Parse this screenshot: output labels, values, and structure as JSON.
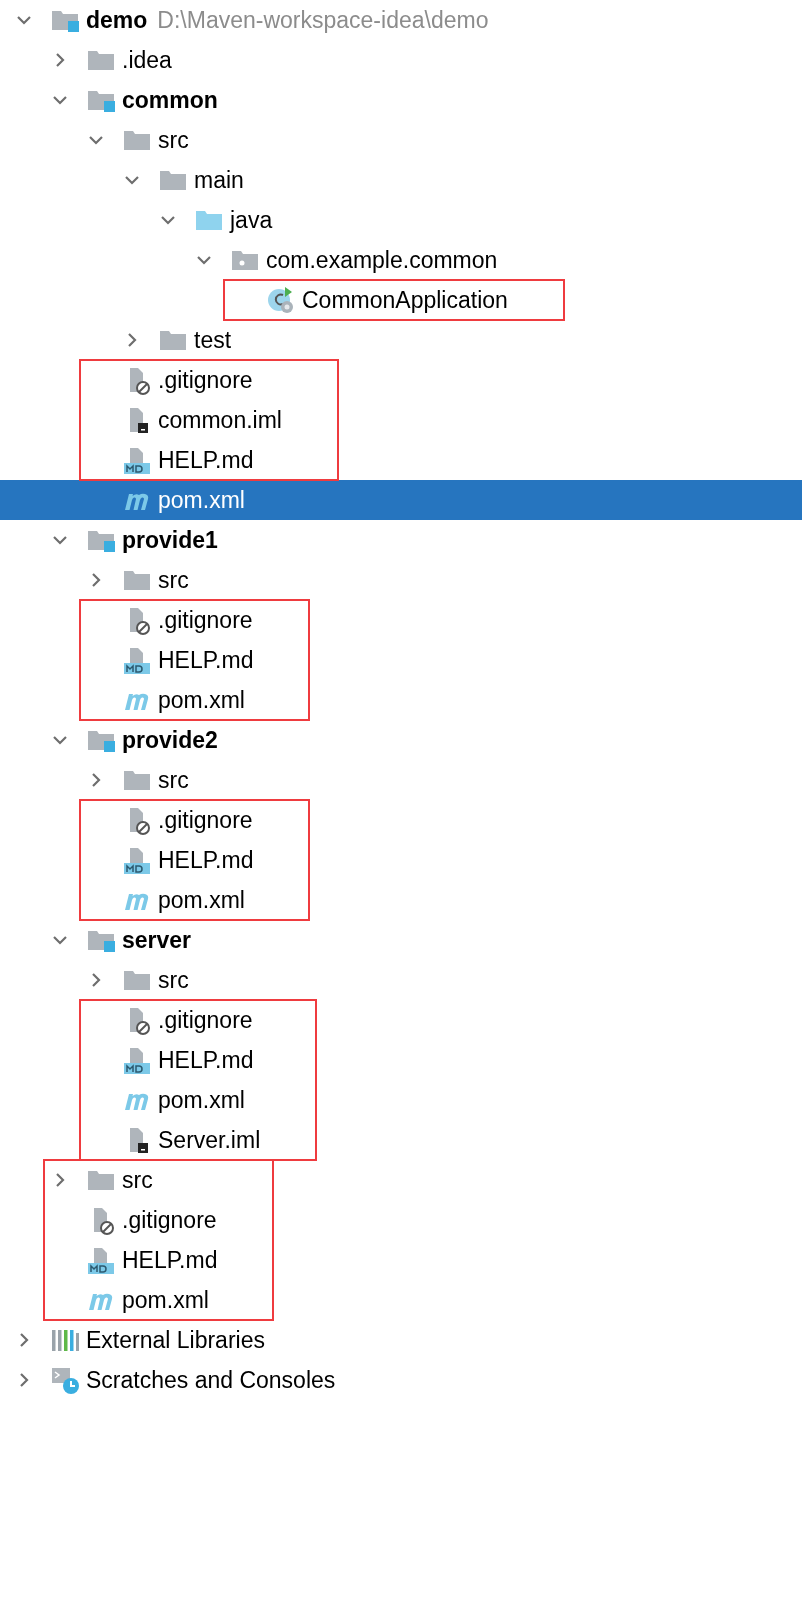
{
  "project_tree": [
    {
      "name": "demo",
      "kind": "module",
      "hint": "D:\\Maven-workspace-idea\\demo",
      "expanded": true,
      "selected": false,
      "highlighted": false,
      "children": [
        {
          "name": ".idea",
          "kind": "folder",
          "expanded": false,
          "selected": false,
          "highlighted": false
        },
        {
          "name": "common",
          "kind": "module",
          "expanded": true,
          "selected": false,
          "highlighted": false,
          "children": [
            {
              "name": "src",
              "kind": "folder",
              "expanded": true,
              "selected": false,
              "highlighted": false,
              "children": [
                {
                  "name": "main",
                  "kind": "folder",
                  "expanded": true,
                  "selected": false,
                  "highlighted": false,
                  "children": [
                    {
                      "name": "java",
                      "kind": "source_folder",
                      "expanded": true,
                      "selected": false,
                      "highlighted": false,
                      "children": [
                        {
                          "name": "com.example.common",
                          "kind": "package",
                          "expanded": true,
                          "selected": false,
                          "highlighted": false,
                          "children": [
                            {
                              "name": "CommonApplication",
                              "kind": "class",
                              "selected": false,
                              "highlighted": true
                            }
                          ]
                        }
                      ]
                    }
                  ]
                },
                {
                  "name": "test",
                  "kind": "folder",
                  "expanded": false,
                  "selected": false,
                  "highlighted": false
                }
              ]
            },
            {
              "name": ".gitignore",
              "kind": "gitignore",
              "selected": false,
              "highlighted": true
            },
            {
              "name": "common.iml",
              "kind": "iml",
              "selected": false,
              "highlighted": true
            },
            {
              "name": "HELP.md",
              "kind": "markdown",
              "selected": false,
              "highlighted": true
            },
            {
              "name": "pom.xml",
              "kind": "maven",
              "selected": true,
              "highlighted": false
            }
          ]
        },
        {
          "name": "provide1",
          "kind": "module",
          "expanded": true,
          "selected": false,
          "highlighted": false,
          "children": [
            {
              "name": "src",
              "kind": "folder",
              "expanded": false,
              "selected": false,
              "highlighted": false
            },
            {
              "name": ".gitignore",
              "kind": "gitignore",
              "selected": false,
              "highlighted": true
            },
            {
              "name": "HELP.md",
              "kind": "markdown",
              "selected": false,
              "highlighted": true
            },
            {
              "name": "pom.xml",
              "kind": "maven",
              "selected": false,
              "highlighted": true
            }
          ]
        },
        {
          "name": "provide2",
          "kind": "module",
          "expanded": true,
          "selected": false,
          "highlighted": false,
          "children": [
            {
              "name": "src",
              "kind": "folder",
              "expanded": false,
              "selected": false,
              "highlighted": false
            },
            {
              "name": ".gitignore",
              "kind": "gitignore",
              "selected": false,
              "highlighted": true
            },
            {
              "name": "HELP.md",
              "kind": "markdown",
              "selected": false,
              "highlighted": true
            },
            {
              "name": "pom.xml",
              "kind": "maven",
              "selected": false,
              "highlighted": true
            }
          ]
        },
        {
          "name": "server",
          "kind": "module",
          "expanded": true,
          "selected": false,
          "highlighted": false,
          "children": [
            {
              "name": "src",
              "kind": "folder",
              "expanded": false,
              "selected": false,
              "highlighted": false
            },
            {
              "name": ".gitignore",
              "kind": "gitignore",
              "selected": false,
              "highlighted": true
            },
            {
              "name": "HELP.md",
              "kind": "markdown",
              "selected": false,
              "highlighted": true
            },
            {
              "name": "pom.xml",
              "kind": "maven",
              "selected": false,
              "highlighted": true
            },
            {
              "name": "Server.iml",
              "kind": "iml",
              "selected": false,
              "highlighted": true
            }
          ]
        },
        {
          "name": "src",
          "kind": "folder",
          "expanded": false,
          "selected": false,
          "highlighted": true
        },
        {
          "name": ".gitignore",
          "kind": "gitignore",
          "selected": false,
          "highlighted": true
        },
        {
          "name": "HELP.md",
          "kind": "markdown",
          "selected": false,
          "highlighted": true
        },
        {
          "name": "pom.xml",
          "kind": "maven",
          "selected": false,
          "highlighted": true
        }
      ]
    },
    {
      "name": "External Libraries",
      "kind": "libraries",
      "expanded": false,
      "selected": false,
      "highlighted": false
    },
    {
      "name": "Scratches and Consoles",
      "kind": "scratches",
      "expanded": false,
      "selected": false,
      "highlighted": false
    }
  ]
}
